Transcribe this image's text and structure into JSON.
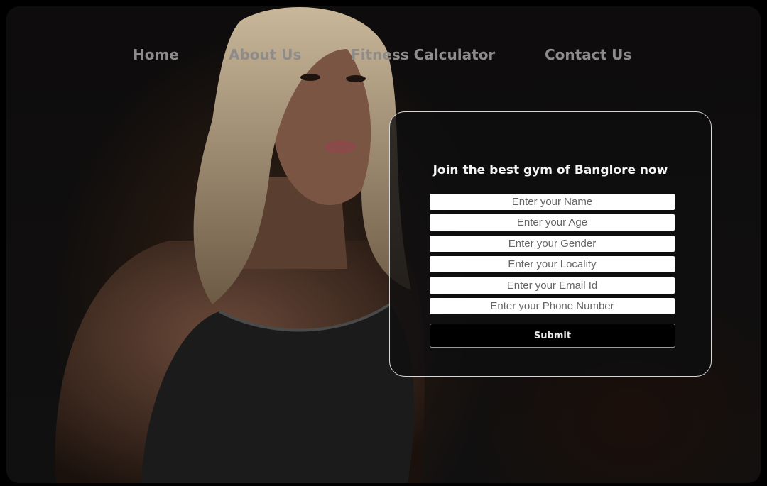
{
  "nav": {
    "items": [
      {
        "label": "Home"
      },
      {
        "label": "About Us"
      },
      {
        "label": "Fitness Calculator"
      },
      {
        "label": "Contact Us"
      }
    ]
  },
  "hero": {
    "image_subject": "woman-in-black-sports-top"
  },
  "form": {
    "title": "Join the best gym of Banglore now",
    "fields": [
      {
        "placeholder": "Enter your Name"
      },
      {
        "placeholder": "Enter your Age"
      },
      {
        "placeholder": "Enter your Gender"
      },
      {
        "placeholder": "Enter your Locality"
      },
      {
        "placeholder": "Enter your Email Id"
      },
      {
        "placeholder": "Enter your Phone Number"
      }
    ],
    "submit_label": "Submit"
  },
  "colors": {
    "nav_text": "#8e8c8b",
    "card_border": "#d8d8d8",
    "button_bg": "#000000"
  }
}
